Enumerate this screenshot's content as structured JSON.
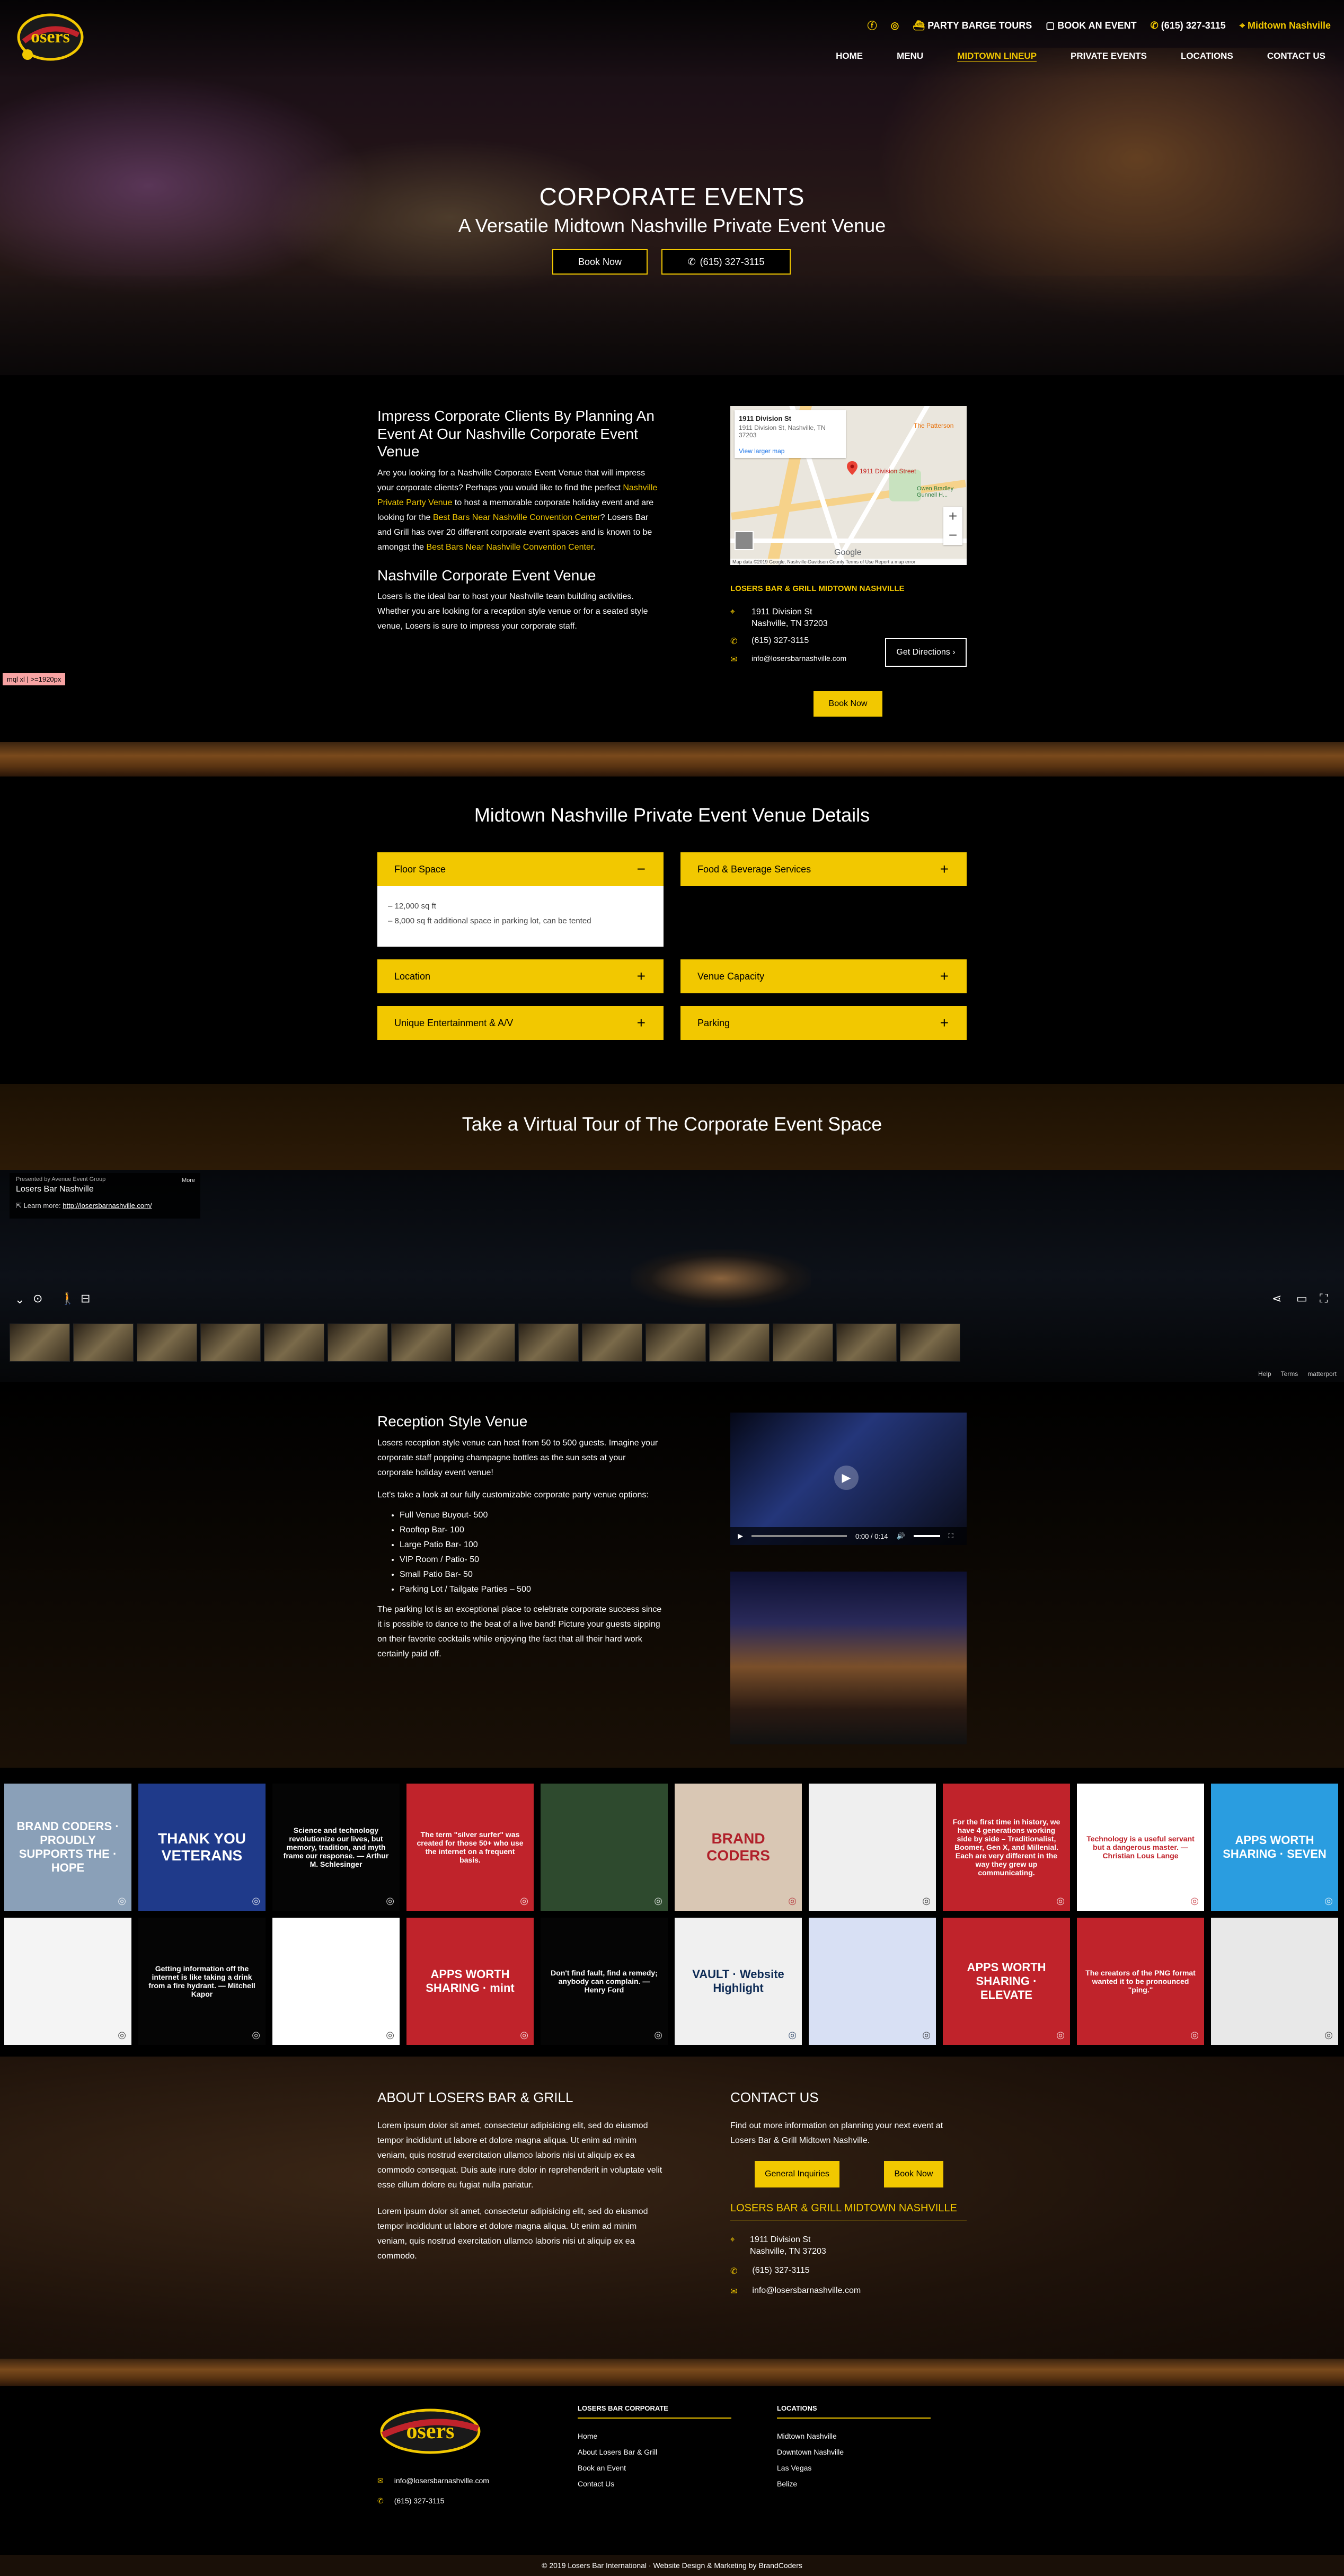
{
  "header": {
    "topbar": {
      "party_barge": "PARTY BARGE TOURS",
      "book_event": "BOOK AN EVENT",
      "phone": "(615) 327-3115",
      "location": "Midtown Nashville"
    },
    "nav": [
      "HOME",
      "MENU",
      "MIDTOWN LINEUP",
      "PRIVATE EVENTS",
      "LOCATIONS",
      "CONTACT US"
    ],
    "logo_text": "osers"
  },
  "hero": {
    "title": "CORPORATE EVENTS",
    "subtitle": "A Versatile Midtown Nashville Private Event Venue",
    "book_now": "Book Now",
    "phone_button": "(615) 327-3115"
  },
  "intro": {
    "heading": "Impress Corporate Clients By Planning An Event At Our Nashville Corporate Event Venue",
    "p1_a": "Are you looking for a Nashville Corporate Event Venue that will impress your corporate clients? Perhaps you would like to find the perfect ",
    "p1_link1": "Nashville Private Party Venue",
    "p1_b": " to host a memorable corporate holiday event and are looking for the ",
    "p1_link2": "Best Bars Near Nashville Convention Center",
    "p1_c": "? Losers Bar and Grill has over 20 different corporate event spaces and is known to be amongst the ",
    "p1_link3": "Best Bars Near Nashville Convention Center",
    "p1_d": ".",
    "heading2": "Nashville Corporate Event Venue",
    "p2": "Losers is the ideal bar to host your Nashville team building activities. Whether you are looking for a reception style venue or for a seated style venue, Losers is sure to impress your corporate staff."
  },
  "map": {
    "place": "1911 Division St",
    "address": "1911 Division St, Nashville, TN 37203",
    "larger_map": "View larger map",
    "pin_label": "1911 Division Street",
    "poi1": "The Patterson",
    "poi2": "Owen Bradley Gunnell H...",
    "google": "Google",
    "footer": "Map data ©2019 Google, Nashville-Davidson County   Terms of Use   Report a map error"
  },
  "location": {
    "title": "LOSERS BAR & GRILL MIDTOWN NASHVILLE",
    "street": "1911 Division St",
    "city": "Nashville, TN 37203",
    "phone": "(615) 327-3115",
    "email": "info@losersbarnashville.com",
    "directions": "Get Directions",
    "book_now": "Book Now"
  },
  "debug_badge": "mql xl | >=1920px",
  "details": {
    "heading": "Midtown Nashville Private Event Venue Details",
    "floor_space": "Floor Space",
    "floor_items": [
      "– 12,000 sq ft",
      "– 8,000 sq ft additional space in parking lot, can be tented"
    ],
    "food": "Food & Beverage Services",
    "location": "Location",
    "capacity": "Venue Capacity",
    "entertainment": "Unique Entertainment & A/V",
    "parking": "Parking"
  },
  "tour": {
    "heading": "Take a Virtual Tour of The Corporate Event Space",
    "presented_by": "Presented by Avenue Event Group",
    "name": "Losers Bar Nashville",
    "more": "More",
    "learn_more": "Learn more:",
    "link": "http://losersbarnashville.com/",
    "help": "Help",
    "terms": "Terms",
    "brand": "matterport"
  },
  "reception": {
    "heading": "Reception Style Venue",
    "p1": "Losers reception style venue can host from 50 to 500 guests. Imagine your corporate staff popping champagne bottles as the sun sets at your corporate holiday event venue!",
    "p2": "Let's take a look at our fully customizable corporate party venue options:",
    "options": [
      "Full Venue Buyout- 500",
      "Rooftop Bar- 100",
      "Large Patio Bar- 100",
      "VIP Room / Patio- 50",
      "Small Patio Bar- 50",
      "Parking Lot / Tailgate Parties – 500"
    ],
    "p3": "The parking lot is an exceptional place to celebrate corporate success since it is possible to dance to the beat of a live band! Picture your guests sipping on their favorite cocktails while enjoying the fact that all their hard work certainly paid off.",
    "video_time": "0:00 / 0:14"
  },
  "instagram": {
    "tiles": [
      {
        "text": "BRAND CODERS · PROUDLY SUPPORTS THE · HOPE",
        "bg": "#8aa0b8",
        "color": "#ffffff"
      },
      {
        "text": "THANK YOU VETERANS",
        "bg": "#1f3a8a",
        "color": "#ffffff"
      },
      {
        "text": "Science and technology revolutionize our lives, but memory, tradition, and myth frame our response. — Arthur M. Schlesinger",
        "bg": "#050505",
        "color": "#ffffff"
      },
      {
        "text": "The term \"silver surfer\" was created for those 50+ who use the internet on a frequent basis.",
        "bg": "#c0232b",
        "color": "#ffffff"
      },
      {
        "text": "",
        "bg": "#2e4a2e",
        "color": "#ffffff"
      },
      {
        "text": "BRAND CODERS",
        "bg": "#d9c7b4",
        "color": "#b0202a"
      },
      {
        "text": "",
        "bg": "#efefef",
        "color": "#111111"
      },
      {
        "text": "For the first time in history, we have 4 generations working side by side – Traditionalist, Boomer, Gen X, and Millenial. Each are very different in the way they grew up communicating.",
        "bg": "#c0232b",
        "color": "#ffffff"
      },
      {
        "text": "Technology is a useful servant but a dangerous master. — Christian Lous Lange",
        "bg": "#ffffff",
        "color": "#c0232b"
      },
      {
        "text": "APPS WORTH SHARING · SEVEN",
        "bg": "#2a9de0",
        "color": "#ffffff"
      },
      {
        "text": "",
        "bg": "#f4f4f4",
        "color": "#222222"
      },
      {
        "text": "Getting information off the internet is like taking a drink from a fire hydrant. — Mitchell Kapor",
        "bg": "#050505",
        "color": "#ffffff"
      },
      {
        "text": "",
        "bg": "#ffffff",
        "color": "#222222"
      },
      {
        "text": "APPS WORTH SHARING · mint",
        "bg": "#c0232b",
        "color": "#ffffff"
      },
      {
        "text": "Don't find fault, find a remedy; anybody can complain. — Henry Ford",
        "bg": "#050505",
        "color": "#ffffff"
      },
      {
        "text": "VAULT · Website Highlight",
        "bg": "#f0f0f0",
        "color": "#0e2b55"
      },
      {
        "text": "",
        "bg": "#d8e0f4",
        "color": "#222222"
      },
      {
        "text": "APPS WORTH SHARING · ELEVATE",
        "bg": "#c0232b",
        "color": "#ffffff"
      },
      {
        "text": "The creators of the PNG format wanted it to be pronounced \"ping.\"",
        "bg": "#c0232b",
        "color": "#ffffff"
      },
      {
        "text": "",
        "bg": "#e8e8e8",
        "color": "#222222"
      }
    ]
  },
  "about": {
    "heading": "ABOUT LOSERS BAR & GRILL",
    "p1": "Lorem ipsum dolor sit amet, consectetur adipisicing elit, sed do eiusmod tempor incididunt ut labore et dolore magna aliqua. Ut enim ad minim veniam, quis nostrud exercitation ullamco laboris nisi ut aliquip ex ea commodo consequat. Duis aute irure dolor in reprehenderit in voluptate velit esse cillum dolore eu fugiat nulla pariatur.",
    "p2": "Lorem ipsum dolor sit amet, consectetur adipisicing elit, sed do eiusmod tempor incididunt ut labore et dolore magna aliqua. Ut enim ad minim veniam, quis nostrud exercitation ullamco laboris nisi ut aliquip ex ea commodo."
  },
  "contact": {
    "heading": "CONTACT US",
    "text": "Find out more information on planning your next event at Losers Bar & Grill Midtown Nashville.",
    "general": "General Inquiries",
    "book_now": "Book Now",
    "location_title": "LOSERS BAR & GRILL MIDTOWN NASHVILLE",
    "street": "1911 Division St",
    "city": "Nashville, TN 37203",
    "phone": "(615) 327-3115",
    "email": "info@losersbarnashville.com"
  },
  "footer": {
    "email": "info@losersbarnashville.com",
    "phone": "(615) 327-3115",
    "corporate_title": "LOSERS BAR CORPORATE",
    "corporate_links": [
      "Home",
      "About Losers Bar & Grill",
      "Book an Event",
      "Contact Us"
    ],
    "locations_title": "LOCATIONS",
    "locations": [
      "Midtown Nashville",
      "Downtown Nashville",
      "Las Vegas",
      "Belize"
    ],
    "copyright": "© 2019 Losers Bar International · Website Design & Marketing by BrandCoders"
  },
  "colors": {
    "accent": "#f2c800",
    "red": "#c0232b"
  }
}
